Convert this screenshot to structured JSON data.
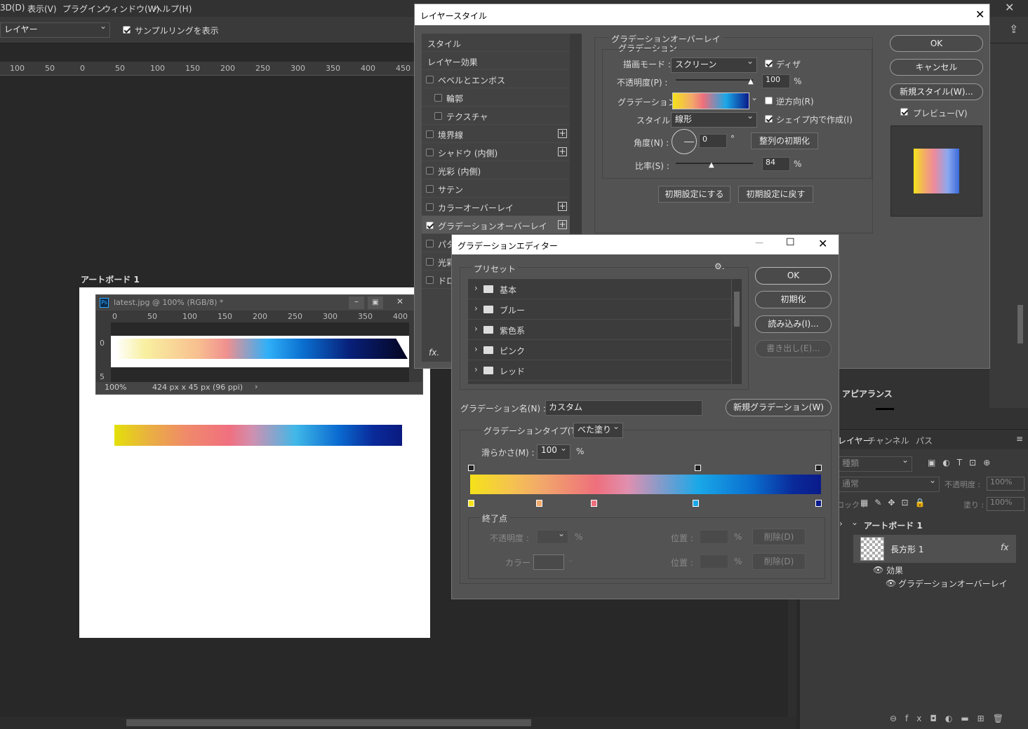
{
  "menu": [
    "3D(D)",
    "表示(V)",
    "プラグイン",
    "ウィンドウ(W)",
    "ヘルプ(H)"
  ],
  "options": {
    "layer_select": "レイヤー",
    "show_ring": "サンプルリングを表示"
  },
  "top_ruler": [
    "100",
    "50",
    "0",
    "50",
    "100",
    "150",
    "200",
    "250",
    "300",
    "350",
    "400",
    "450"
  ],
  "artboard_label": "アートボード 1",
  "doc": {
    "tab": "latest.jpg @ 100% (RGB/8) *",
    "ruler": [
      "0",
      "50",
      "100",
      "150",
      "200",
      "250",
      "300",
      "350",
      "400"
    ],
    "vruler": [
      "0",
      "5"
    ],
    "zoom": "100%",
    "info": "424 px x 45 px (96 ppi)"
  },
  "layer_style": {
    "title": "レイヤースタイル",
    "list": [
      {
        "label": "スタイル",
        "check": false,
        "plus": false,
        "checkbox": false
      },
      {
        "label": "レイヤー効果",
        "check": false,
        "plus": false,
        "checkbox": false
      },
      {
        "label": "ベベルとエンボス",
        "check": false,
        "plus": false,
        "checkbox": true
      },
      {
        "label": "輪郭",
        "check": false,
        "plus": false,
        "checkbox": true,
        "indent": true
      },
      {
        "label": "テクスチャ",
        "check": false,
        "plus": false,
        "checkbox": true,
        "indent": true
      },
      {
        "label": "境界線",
        "check": false,
        "plus": true,
        "checkbox": true
      },
      {
        "label": "シャドウ (内側)",
        "check": false,
        "plus": true,
        "checkbox": true
      },
      {
        "label": "光彩 (内側)",
        "check": false,
        "plus": false,
        "checkbox": true
      },
      {
        "label": "サテン",
        "check": false,
        "plus": false,
        "checkbox": true
      },
      {
        "label": "カラーオーバーレイ",
        "check": false,
        "plus": true,
        "checkbox": true
      },
      {
        "label": "グラデーションオーバーレイ",
        "check": true,
        "plus": true,
        "checkbox": true,
        "selected": true
      },
      {
        "label": "パタ",
        "check": false,
        "plus": false,
        "checkbox": true
      },
      {
        "label": "光彩",
        "check": false,
        "plus": false,
        "checkbox": true
      },
      {
        "label": "ドロ",
        "check": false,
        "plus": false,
        "checkbox": true
      }
    ],
    "fx": "fx.",
    "group_title": "グラデーションオーバーレイ",
    "sub_title": "グラデーション",
    "blend_label": "描画モード :",
    "blend_value": "スクリーン",
    "dither": "ディザ",
    "opacity_label": "不透明度(P) :",
    "opacity_value": "100",
    "pct": "%",
    "gradient_label": "グラデーション :",
    "reverse": "逆方向(R)",
    "style_label": "スタイル :",
    "style_value": "線形",
    "align": "シェイプ内で作成(I)",
    "angle_label": "角度(N) :",
    "angle_value": "0",
    "deg": "°",
    "reset_align": "整列の初期化",
    "scale_label": "比率(S) :",
    "scale_value": "84",
    "make_default": "初期設定にする",
    "reset_default": "初期設定に戻す",
    "ok": "OK",
    "cancel": "キャンセル",
    "new_style": "新規スタイル(W)...",
    "preview": "プレビュー(V)"
  },
  "gradient_editor": {
    "title": "グラデーションエディター",
    "presets_label": "プリセット",
    "folders": [
      "基本",
      "ブルー",
      "紫色系",
      "ピンク",
      "レッド"
    ],
    "ok": "OK",
    "reset": "初期化",
    "load": "読み込み(I)...",
    "export": "書き出し(E)...",
    "name_label": "グラデーション名(N) :",
    "name_value": "カスタム",
    "new_gradient": "新規グラデーション(W)",
    "type_label": "グラデーションタイプ(T) :",
    "type_value": "べた塗り",
    "smooth_label": "滑らかさ(M) :",
    "smooth_value": "100",
    "pct": "%",
    "stops_label": "終了点",
    "opacity_label": "不透明度 :",
    "position_label": "位置 :",
    "delete_label": "削除(D)",
    "color_label": "カラー :",
    "color_stops": [
      "#f5e21a",
      "#f2a96a",
      "#ee6f7c",
      "#1aa8e8",
      "#0a1b8a"
    ]
  },
  "right_panel": {
    "appearance": "アピアランス",
    "tabs": [
      "レイヤー",
      "チャンネル",
      "パス"
    ],
    "filter": "種類",
    "blend": "通常",
    "opacity_label": "不透明度 :",
    "opacity_value": "100%",
    "lock_label": "ロック :",
    "fill_label": "塗り :",
    "fill_value": "100%",
    "artboard": "アートボード 1",
    "layer": "長方形 1",
    "effects": "効果",
    "effect_item": "グラデーションオーバーレイ"
  }
}
